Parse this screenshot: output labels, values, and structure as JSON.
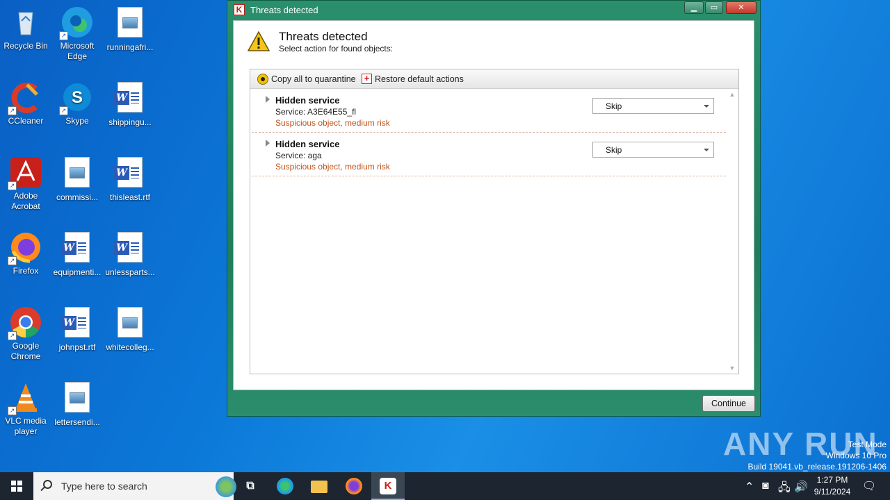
{
  "desktop": {
    "icons": [
      {
        "label": "Recycle Bin",
        "icon": "recycle-bin-icon"
      },
      {
        "label": "Microsoft Edge",
        "icon": "edge-icon"
      },
      {
        "label": "runningafri...",
        "icon": "image-file-icon"
      },
      {
        "label": "CCleaner",
        "icon": "ccleaner-icon"
      },
      {
        "label": "Skype",
        "icon": "skype-icon"
      },
      {
        "label": "shippingu...",
        "icon": "word-doc-icon"
      },
      {
        "label": "Adobe Acrobat",
        "icon": "acrobat-icon"
      },
      {
        "label": "commissi...",
        "icon": "image-file-icon"
      },
      {
        "label": "thisleast.rtf",
        "icon": "word-doc-icon"
      },
      {
        "label": "Firefox",
        "icon": "firefox-icon"
      },
      {
        "label": "equipmenti...",
        "icon": "word-doc-icon"
      },
      {
        "label": "unlessparts...",
        "icon": "word-doc-icon"
      },
      {
        "label": "Google Chrome",
        "icon": "chrome-icon"
      },
      {
        "label": "johnpst.rtf",
        "icon": "word-doc-icon"
      },
      {
        "label": "whitecolleg...",
        "icon": "image-file-icon"
      },
      {
        "label": "VLC media player",
        "icon": "vlc-icon"
      },
      {
        "label": "lettersendi...",
        "icon": "image-file-icon"
      }
    ]
  },
  "dialog": {
    "window_title": "Threats detected",
    "heading": "Threats detected",
    "subheading": "Select action for found objects:",
    "toolbar": {
      "copy_quarantine": "Copy all to quarantine",
      "restore_defaults": "Restore default actions"
    },
    "threats": [
      {
        "name": "Hidden service",
        "service": "Service: A3E64E55_fl",
        "risk": "Suspicious object, medium risk",
        "action": "Skip"
      },
      {
        "name": "Hidden service",
        "service": "Service: aga",
        "risk": "Suspicious object, medium risk",
        "action": "Skip"
      }
    ],
    "continue_label": "Continue",
    "colors": {
      "frame": "#2a8f6c",
      "risk_text": "#c0531a"
    }
  },
  "watermark": {
    "logo": "ANY RUN",
    "line1": "Test Mode",
    "line2": "Windows 10 Pro",
    "line3": "Build 19041.vb_release.191206-1406"
  },
  "taskbar": {
    "search_placeholder": "Type here to search",
    "time": "1:27 PM",
    "date": "9/11/2024"
  }
}
